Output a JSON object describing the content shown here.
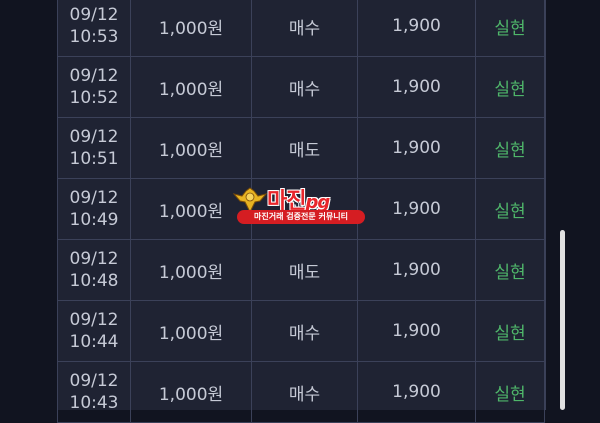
{
  "columns": [
    "time",
    "amount",
    "side",
    "price",
    "status"
  ],
  "trades": [
    {
      "date": "09/12",
      "time": "10:53",
      "amount": "1,000원",
      "side": "매수",
      "price": "1,900",
      "status": "실현"
    },
    {
      "date": "09/12",
      "time": "10:52",
      "amount": "1,000원",
      "side": "매수",
      "price": "1,900",
      "status": "실현"
    },
    {
      "date": "09/12",
      "time": "10:51",
      "amount": "1,000원",
      "side": "매도",
      "price": "1,900",
      "status": "실현"
    },
    {
      "date": "09/12",
      "time": "10:49",
      "amount": "1,000원",
      "side": "매수",
      "price": "1,900",
      "status": "실현"
    },
    {
      "date": "09/12",
      "time": "10:48",
      "amount": "1,000원",
      "side": "매도",
      "price": "1,900",
      "status": "실현"
    },
    {
      "date": "09/12",
      "time": "10:44",
      "amount": "1,000원",
      "side": "매수",
      "price": "1,900",
      "status": "실현"
    },
    {
      "date": "09/12",
      "time": "10:43",
      "amount": "1,000원",
      "side": "매수",
      "price": "1,900",
      "status": "실현"
    }
  ],
  "watermark": {
    "title_main": "마진",
    "title_accent": "pg",
    "banner": "마진거래 검증전문 커뮤니티"
  },
  "colors": {
    "background": "#111420",
    "panel": "#1f2333",
    "grid": "#3b4159",
    "text": "#c6cad6",
    "status_realized": "#4fb66a",
    "watermark_red": "#e8262b"
  }
}
